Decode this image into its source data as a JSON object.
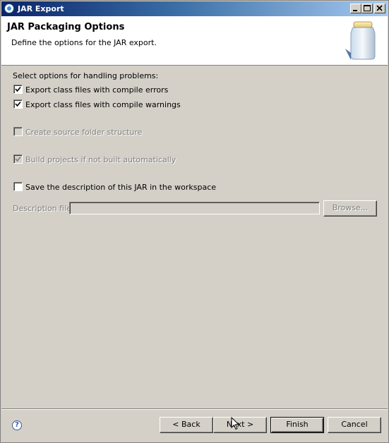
{
  "window": {
    "title": "JAR Export"
  },
  "header": {
    "title": "JAR Packaging Options",
    "description": "Define the options for the JAR export."
  },
  "options": {
    "section_label": "Select options for handling problems:",
    "export_errors": {
      "label": "Export class files with compile errors",
      "checked": true,
      "enabled": true
    },
    "export_warnings": {
      "label": "Export class files with compile warnings",
      "checked": true,
      "enabled": true
    },
    "source_folder": {
      "label": "Create source folder structure",
      "checked": false,
      "enabled": false
    },
    "build_projects": {
      "label": "Build projects if not built automatically",
      "checked": true,
      "enabled": false
    },
    "save_description": {
      "label": "Save the description of this JAR in the workspace",
      "checked": false,
      "enabled": true
    }
  },
  "description_file": {
    "label": "Description file:",
    "value": "",
    "browse_label": "Browse..."
  },
  "buttons": {
    "back": "< Back",
    "next": "Next >",
    "finish": "Finish",
    "cancel": "Cancel"
  },
  "icons": {
    "title": "eclipse-icon",
    "header": "jar-icon",
    "help": "help-icon"
  }
}
